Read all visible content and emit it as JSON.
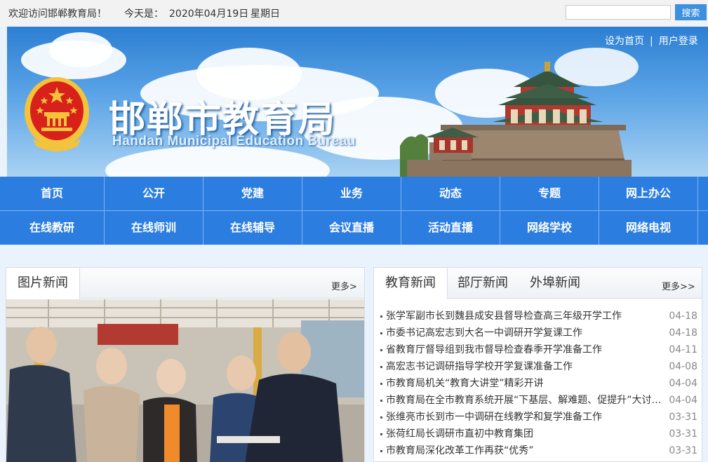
{
  "topbar": {
    "welcome": "欢迎访问邯郸教育局！",
    "today_label": "今天是：",
    "date": "2020年04月19日",
    "weekday": "星期日",
    "search_placeholder": "",
    "search_button": "搜索"
  },
  "banner": {
    "title": "邯郸市教育局",
    "title_en": "Handan Municipal Education Bureau",
    "set_home": "设为首页",
    "separator": "|",
    "login": "用户登录"
  },
  "nav": {
    "row1": [
      "首页",
      "公开",
      "党建",
      "业务",
      "动态",
      "专题",
      "网上办公"
    ],
    "row2": [
      "在线教研",
      "在线师训",
      "在线辅导",
      "会议直播",
      "活动直播",
      "网络学校",
      "网络电视"
    ]
  },
  "photo_news": {
    "tab": "图片新闻",
    "more": "更多>"
  },
  "news": {
    "tabs": [
      "教育新闻",
      "部厅新闻",
      "外埠新闻"
    ],
    "active_tab": "教育新闻",
    "more": "更多>>",
    "items": [
      {
        "title": "张学军副市长到魏县成安县督导检查高三年级开学工作",
        "date": "04-18"
      },
      {
        "title": "市委书记高宏志到大名一中调研开学复课工作",
        "date": "04-18"
      },
      {
        "title": "省教育厅督导组到我市督导检查春季开学准备工作",
        "date": "04-11"
      },
      {
        "title": "高宏志书记调研指导学校开学复课准备工作",
        "date": "04-08"
      },
      {
        "title": "市教育局机关“教育大讲堂”精彩开讲",
        "date": "04-04"
      },
      {
        "title": "市教育局在全市教育系统开展“下基层、解难题、促提升”大讨论活动",
        "date": "04-04"
      },
      {
        "title": "张维亮市长到市一中调研在线教学和复学准备工作",
        "date": "03-31"
      },
      {
        "title": "张荷红局长调研市直初中教育集团",
        "date": "03-31"
      },
      {
        "title": "市教育局深化改革工作再获“优秀”",
        "date": "03-31"
      }
    ]
  },
  "colors": {
    "nav_blue": "#2b7de0",
    "search_button": "#3d8fe0",
    "emblem_red": "#d8211a",
    "emblem_gold": "#f3c33c"
  }
}
